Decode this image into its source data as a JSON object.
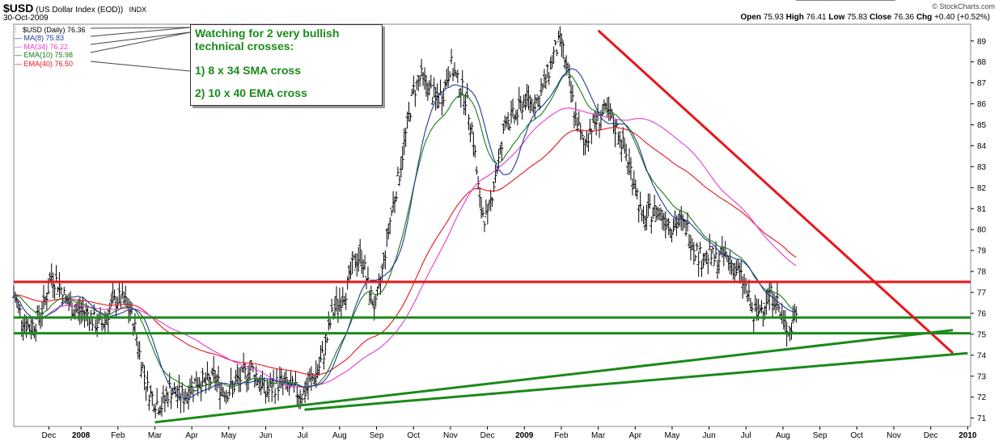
{
  "header": {
    "symbol": "$USD",
    "description": "(US Dollar Index (EOD))",
    "exchange": "INDX",
    "date": "30-Oct-2009",
    "brand": "© StockCharts.com"
  },
  "ohlc": {
    "open_label": "Open",
    "open": "75.93",
    "high_label": "High",
    "high": "76.41",
    "low_label": "Low",
    "low": "75.83",
    "close_label": "Close",
    "close": "76.36",
    "chg_label": "Chg",
    "chg": "+0.40 (+0.52%)"
  },
  "legend": [
    {
      "label": "$USD (Daily) 76.36",
      "color": "#000000",
      "icon": "ohlc-bars"
    },
    {
      "label": "MA(8) 75.83",
      "color": "#1f3a93"
    },
    {
      "label": "MA(34) 76.22",
      "color": "#e83ad0"
    },
    {
      "label": "EMA(10) 75.98",
      "color": "#1a7a1a"
    },
    {
      "label": "EMA(40) 76.50",
      "color": "#e8151b"
    }
  ],
  "annotation": {
    "line1": "Watching for 2 very bullish",
    "line2": "technical crosses:",
    "line3": "1) 8 x 34 SMA cross",
    "line4": "2) 10 x 40 EMA cross"
  },
  "chart_data": {
    "type": "line",
    "title": "$USD (US Dollar Index (EOD)) INDX",
    "ylim": [
      70.6,
      89.8
    ],
    "yticks": [
      71,
      72,
      73,
      74,
      75,
      76,
      77,
      78,
      79,
      80,
      81,
      82,
      83,
      84,
      85,
      86,
      87,
      88,
      89
    ],
    "xlabels": [
      {
        "label": "Dec",
        "t": 0.13
      },
      {
        "label": "2008",
        "t": 1.0,
        "bold": true
      },
      {
        "label": "Feb",
        "t": 2.0
      },
      {
        "label": "Mar",
        "t": 3.0
      },
      {
        "label": "Apr",
        "t": 4.0
      },
      {
        "label": "May",
        "t": 5.0
      },
      {
        "label": "Jun",
        "t": 6.0
      },
      {
        "label": "Jul",
        "t": 7.0
      },
      {
        "label": "Aug",
        "t": 8.0
      },
      {
        "label": "Sep",
        "t": 9.0
      },
      {
        "label": "Oct",
        "t": 10.0
      },
      {
        "label": "Nov",
        "t": 11.0
      },
      {
        "label": "Dec",
        "t": 12.0
      },
      {
        "label": "2009",
        "t": 13.0,
        "bold": true
      },
      {
        "label": "Feb",
        "t": 14.0
      },
      {
        "label": "Mar",
        "t": 15.0
      },
      {
        "label": "Apr",
        "t": 16.0
      },
      {
        "label": "May",
        "t": 17.0
      },
      {
        "label": "Jun",
        "t": 18.0
      },
      {
        "label": "Jul",
        "t": 19.0
      },
      {
        "label": "Aug",
        "t": 20.0
      },
      {
        "label": "Sep",
        "t": 21.0
      },
      {
        "label": "Oct",
        "t": 22.0
      },
      {
        "label": "Nov",
        "t": 23.0
      },
      {
        "label": "Dec",
        "t": 24.0
      },
      {
        "label": "2010",
        "t": 25.0,
        "bold": true
      }
    ],
    "series": [
      {
        "name": "$USD (Daily)",
        "color": "#000000",
        "style": "ohlc",
        "t": [
          -0.82,
          -0.6,
          -0.4,
          -0.2,
          0.0,
          0.2,
          0.4,
          0.6,
          0.8,
          1.0,
          1.2,
          1.4,
          1.6,
          1.8,
          2.0,
          2.2,
          2.4,
          2.6,
          2.8,
          3.0,
          3.2,
          3.4,
          3.6,
          3.8,
          4.0,
          4.2,
          4.4,
          4.6,
          4.8,
          5.0,
          5.2,
          5.4,
          5.6,
          5.8,
          6.0,
          6.2,
          6.4,
          6.6,
          6.8,
          7.0,
          7.2,
          7.4,
          7.6,
          7.8,
          8.0,
          8.2,
          8.4,
          8.6,
          8.8,
          9.0,
          9.2,
          9.4,
          9.6,
          9.8,
          10.0,
          10.2,
          10.4,
          10.6,
          10.8,
          11.0,
          11.2,
          11.4,
          11.6,
          11.8,
          12.0,
          12.2,
          12.4,
          12.5,
          12.6,
          12.8,
          13.0,
          13.2,
          13.4,
          13.6,
          13.8,
          14.0,
          14.2,
          14.4,
          14.6,
          14.8,
          15.0,
          15.2,
          15.4,
          15.6,
          15.8,
          16.0,
          16.2,
          16.4,
          16.6,
          16.8,
          17.0,
          17.2,
          17.4,
          17.6,
          17.8,
          18.0,
          18.2,
          18.4,
          18.6,
          18.8,
          19.0,
          19.2,
          19.4,
          19.6,
          19.8,
          20.0,
          20.2,
          20.4,
          20.6,
          20.8,
          21.0,
          21.2,
          21.4,
          21.6,
          21.8,
          22.0,
          22.2,
          22.4,
          22.6,
          22.8,
          23.0
        ],
        "values": [
          76.9,
          75.8,
          75.3,
          75.6,
          76.4,
          77.8,
          77.4,
          76.6,
          76.2,
          76.1,
          76.0,
          75.5,
          75.5,
          76.3,
          76.7,
          76.5,
          75.8,
          74.0,
          72.4,
          71.8,
          71.6,
          72.4,
          72.1,
          72.0,
          72.6,
          72.8,
          72.6,
          73.0,
          72.4,
          72.3,
          72.7,
          73.0,
          73.4,
          72.9,
          72.2,
          72.5,
          72.7,
          72.5,
          72.3,
          72.1,
          72.7,
          73.2,
          74.3,
          76.0,
          76.6,
          77.2,
          78.5,
          78.8,
          77.0,
          76.2,
          78.6,
          80.8,
          82.5,
          84.6,
          86.6,
          87.3,
          86.8,
          86.2,
          86.5,
          87.9,
          87.0,
          86.4,
          84.7,
          81.1,
          80.4,
          82.5,
          84.0,
          85.5,
          85.2,
          85.5,
          86.2,
          86.1,
          86.2,
          87.2,
          88.4,
          89.0,
          87.1,
          85.3,
          84.0,
          84.9,
          85.3,
          85.6,
          85.1,
          84.4,
          83.3,
          82.2,
          80.3,
          80.8,
          80.9,
          80.6,
          80.2,
          80.3,
          80.1,
          79.2,
          78.6,
          78.8,
          78.5,
          78.8,
          78.4,
          77.9,
          77.2,
          75.8,
          76.2,
          76.9,
          76.8,
          75.5,
          75.2,
          76.4
        ],
        "tip_note": ""
      },
      {
        "name": "MA(8)",
        "color": "#1f3a93",
        "values_ref": "smooth-8"
      },
      {
        "name": "MA(34)",
        "color": "#e83ad0",
        "values_ref": "smooth-34"
      },
      {
        "name": "EMA(10)",
        "color": "#1a7a1a",
        "values_ref": "smooth-10"
      },
      {
        "name": "EMA(40)",
        "color": "#e8151b",
        "values_ref": "smooth-40"
      }
    ],
    "trendlines": [
      {
        "name": "resistance-horizontal",
        "color": "#e8151b",
        "from": [
          -1.0,
          77.5
        ],
        "to": [
          26.0,
          77.5
        ]
      },
      {
        "name": "support-horizontal-upper",
        "color": "#1a8a1a",
        "from": [
          -1.0,
          75.8
        ],
        "to": [
          26.0,
          75.8
        ]
      },
      {
        "name": "support-horizontal-lower",
        "color": "#1a8a1a",
        "from": [
          -1.0,
          75.05
        ],
        "to": [
          26.0,
          75.05
        ]
      },
      {
        "name": "downtrend",
        "color": "#e8151b",
        "from": [
          15.0,
          89.5
        ],
        "to": [
          24.6,
          74.1
        ]
      },
      {
        "name": "uptrend-2008",
        "color": "#1a8a1a",
        "from": [
          3.0,
          70.8
        ],
        "to": [
          24.6,
          75.2
        ]
      },
      {
        "name": "uptrend-long",
        "color": "#1a8a1a",
        "from": [
          7.05,
          71.4
        ],
        "to": [
          25.0,
          74.1
        ]
      }
    ]
  }
}
